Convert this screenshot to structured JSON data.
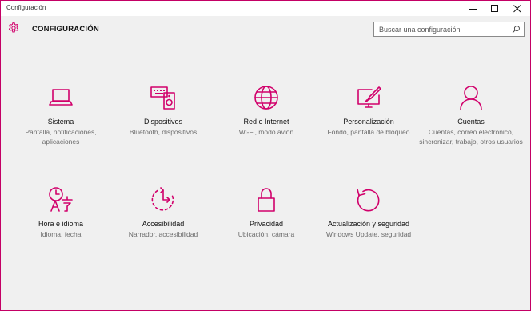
{
  "window": {
    "title": "Configuración"
  },
  "header": {
    "title": "CONFIGURACIÓN",
    "search_placeholder": "Buscar una configuración"
  },
  "accent_color": "#d1006b",
  "tiles": [
    {
      "label": "Sistema",
      "desc": "Pantalla, notificaciones, aplicaciones",
      "icon": "laptop-icon"
    },
    {
      "label": "Dispositivos",
      "desc": "Bluetooth, dispositivos",
      "icon": "devices-icon"
    },
    {
      "label": "Red e Internet",
      "desc": "Wi-Fi, modo avión",
      "icon": "globe-icon"
    },
    {
      "label": "Personalización",
      "desc": "Fondo, pantalla de bloqueo",
      "icon": "paint-monitor-icon"
    },
    {
      "label": "Cuentas",
      "desc": "Cuentas, correo electrónico, sincronizar, trabajo, otros usuarios",
      "icon": "person-icon"
    },
    {
      "label": "Hora e idioma",
      "desc": "Idioma, fecha",
      "icon": "time-language-icon"
    },
    {
      "label": "Accesibilidad",
      "desc": "Narrador, accesibilidad",
      "icon": "ease-of-access-icon"
    },
    {
      "label": "Privacidad",
      "desc": "Ubicación, cámara",
      "icon": "lock-icon"
    },
    {
      "label": "Actualización y seguridad",
      "desc": "Windows Update, seguridad",
      "icon": "update-icon"
    }
  ]
}
